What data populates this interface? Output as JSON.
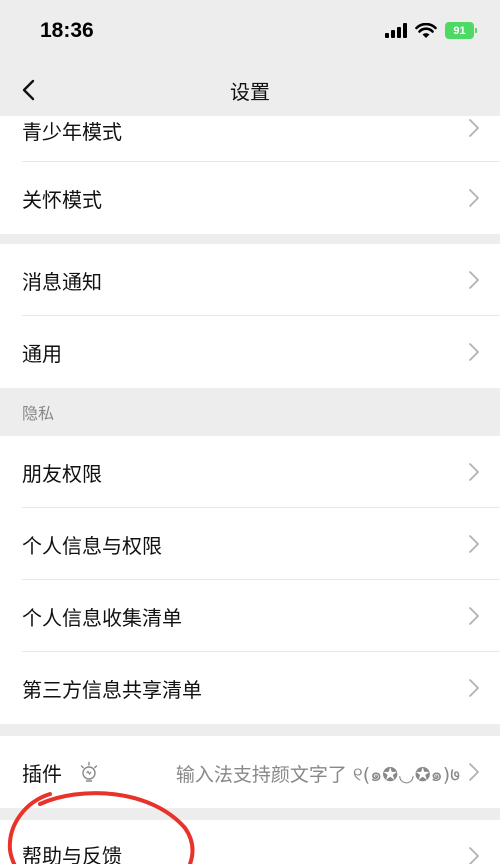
{
  "status_bar": {
    "time": "18:36",
    "battery": "91"
  },
  "nav": {
    "title": "设置"
  },
  "group1": [
    {
      "label": "青少年模式"
    },
    {
      "label": "关怀模式"
    }
  ],
  "group2": [
    {
      "label": "消息通知"
    },
    {
      "label": "通用"
    }
  ],
  "privacy_section": {
    "header": "隐私",
    "items": [
      {
        "label": "朋友权限"
      },
      {
        "label": "个人信息与权限"
      },
      {
        "label": "个人信息收集清单"
      },
      {
        "label": "第三方信息共享清单"
      }
    ]
  },
  "plugins": {
    "label": "插件",
    "value": "输入法支持颜文字了 ୧(๑✪◡✪๑)७"
  },
  "help": {
    "label": "帮助与反馈"
  },
  "colors": {
    "background": "#ededed",
    "battery": "#4cd964",
    "annotation": "#e8322a"
  }
}
